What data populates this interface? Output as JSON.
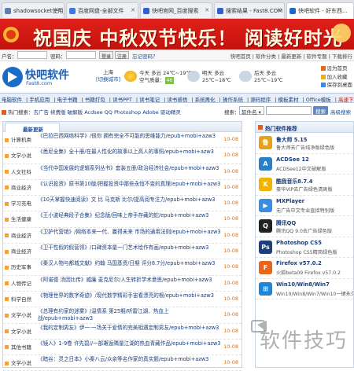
{
  "tabs": [
    {
      "label": "shadowsocket使用_..."
    },
    {
      "label": "百度网盘-全部文件"
    },
    {
      "label": "快吧官网_百度搜索"
    },
    {
      "label": "搜索结果 - Fast8.COM"
    },
    {
      "label": "快吧软件 - 好东西..."
    }
  ],
  "banner": {
    "text": "祝国庆 中秋双节快乐！ 阅读好时光"
  },
  "topbar": {
    "user_label": "户名：",
    "pass_label": "密码：",
    "login_label": "登录",
    "register_label": "注册",
    "forgot_label": "忘记密码？",
    "links": "快吧首页 | 软件分类 | 最新更新 | 软件专题 | 下载排行"
  },
  "header": {
    "logo_text": "快吧软件",
    "logo_sub": "Fast8.com",
    "city": "上海",
    "city_sub": "[切换城市]",
    "weather": [
      {
        "day": "今天",
        "desc": "多云",
        "temp": "24℃~19℃",
        "aqi_label": "空气质量：",
        "aqi": "46"
      },
      {
        "day": "明天",
        "desc": "多云",
        "temp": "25℃~18℃"
      },
      {
        "day": "后天",
        "desc": "多云",
        "temp": "25℃~19℃"
      }
    ],
    "side_links": [
      "设为首页",
      "加入收藏",
      "保存到桌面"
    ]
  },
  "nav": {
    "items": [
      "电脑软件",
      "手机应用",
      "电子书籍",
      "书籍打包",
      "读书PPT",
      "读书笔记",
      "读书感悟",
      "系统再化",
      "操作系统",
      "源码程序",
      "模板素材",
      "Office模板"
    ],
    "hot": "高速下载"
  },
  "search": {
    "hot_label": "热门搜索：",
    "hot_terms": "去广告 续费版 破解版 Acdsee QQ Photoshop Adobe 驱动精灵",
    "label": "搜索：",
    "scope": "软件名",
    "button": "搜索",
    "advanced": "高级搜索"
  },
  "latest": {
    "tab": "最新更新",
    "rows": [
      {
        "cat": "计算机类",
        "title": "《巴拉巴西网络科学》/很你 拥有完全不可能的思维能力/epub+mobi+azw3",
        "date": "10-08"
      },
      {
        "cat": "文学小说",
        "title": "《悉尼全集》全十册/在最人性化的故事以上高人的事照/epub+mobi+azw3",
        "date": "10-08"
      },
      {
        "cat": "人文社科",
        "title": "《当代中国发展的逻辑系列丛书》套装五册/政治经济社会/epub+mobi+azw3",
        "date": "10-08"
      },
      {
        "cat": "商业经济",
        "title": "《认识投资》原书第10版/把握投资中那些永恒不变的真理/epub+mobi+azw3",
        "date": "10-08"
      },
      {
        "cat": "学习充电",
        "title": "《10天掌握快速阅读》文 比 马克斯 比尔/提高阅专注力/epub+mobi+azw3",
        "date": "10-08"
      },
      {
        "cat": "生活健康",
        "title": "《王小波经典段子合集》纪念版/回味上帝手存藏的蛇/epub+mobi+azw3",
        "date": "10-08"
      },
      {
        "cat": "商业经济",
        "title": "《卫护代营销》/网络本来一代、赢得未来 市场的通用法则/epub+mobi+azw3",
        "date": "10-08"
      },
      {
        "cat": "商业经济",
        "title": "《卫干性假的假营领》/口碑资本量一门艺术绘作有画/epub+mobi+azw3",
        "date": "10-08"
      },
      {
        "cat": "历史军事",
        "title": "《秦汉人物与都城文献》约翰 马国基资/日期 评分8.7分/epub+mobi+azw3",
        "date": "10-08"
      },
      {
        "cat": "人物传记",
        "title": "《阿诺德 汤因比传》威廉 麦克尼尔/人生转折学术意思/epub+mobi+azw3",
        "date": "10-08"
      },
      {
        "cat": "科学自然",
        "title": "《物理世界的数字奇迹》/现代数学精彩手宙看漂亮的根/epub+mobi+azw3",
        "date": "10-08"
      },
      {
        "cat": "文学小说",
        "title": "《总理有约家的迷雾》/温情系 第25期/听雷江湖、热血上战/epub+mobi+azw3",
        "date": "10-08"
      },
      {
        "cat": "文学小说",
        "title": "《我的定制男友》伊一·一场关于爱情的完美相遇定制男友/epub+mobi+azw3",
        "date": "10-08"
      },
      {
        "cat": "其他书籍",
        "title": "《镜入》1-9卷 许先碧//一部邂逅隅量江湖的热血青藏作品/epub+mobi+azw3",
        "date": "10-08"
      },
      {
        "cat": "文学小说",
        "title": "《暗谷：灵之日本》小秦八云/众余等名作家的真实题/epub+mobi+azw3",
        "date": "10-08"
      }
    ]
  },
  "hot_software": {
    "title": "热门软件推荐",
    "items": [
      {
        "name": "鲁大师 5.15",
        "desc": "鲁大师去广告纯净版绿色版",
        "color": "#e8a21a",
        "glyph": "鲁"
      },
      {
        "name": "ACDSee 12",
        "desc": "ACDSee12中文破解版",
        "color": "#2a7fc9",
        "glyph": "A"
      },
      {
        "name": "酷我音乐8.7.4",
        "desc": "豪华VIP去广告绿色清爽版",
        "color": "#f1b400",
        "glyph": "K"
      },
      {
        "name": "MXPlayer",
        "desc": "无广告中文专业直接特别版",
        "color": "#3a8de0",
        "glyph": "▶"
      },
      {
        "name": "腾讯QQ",
        "desc": "腾讯QQ 9.0去广告绿色版",
        "color": "#222222",
        "glyph": "Q"
      },
      {
        "name": "Photoshop CS5",
        "desc": "Photoshop CS5精简绿色版",
        "color": "#1f3f7a",
        "glyph": "Ps"
      },
      {
        "name": "Firefox v57.0.2",
        "desc": "火狐beta09 Firefox v57.0.2",
        "color": "#e8661a",
        "glyph": "F"
      },
      {
        "name": "Win10/Win8/Win7",
        "desc": "Win10/Win8/Win7/Win10一键永久激活",
        "color": "#1d86d8",
        "glyph": "⊞"
      }
    ]
  },
  "watermark": "软件技巧"
}
